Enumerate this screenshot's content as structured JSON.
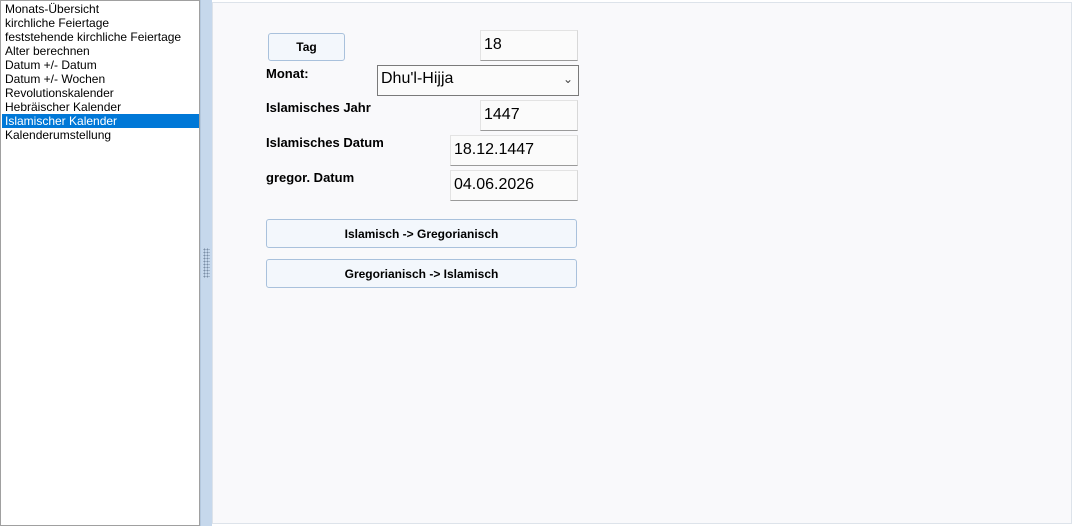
{
  "sidebar": {
    "items": [
      {
        "label": "Monats-Übersicht"
      },
      {
        "label": "kirchliche Feiertage"
      },
      {
        "label": "feststehende kirchliche Feiertage"
      },
      {
        "label": "Alter berechnen"
      },
      {
        "label": "Datum +/- Datum"
      },
      {
        "label": "Datum +/- Wochen"
      },
      {
        "label": "Revolutionskalender"
      },
      {
        "label": "Hebräischer Kalender"
      },
      {
        "label": "Islamischer Kalender"
      },
      {
        "label": "Kalenderumstellung"
      }
    ],
    "selected_index": 8
  },
  "form": {
    "tag_button": "Tag",
    "tag_value": "18",
    "monat_label": "Monat:",
    "monat_value": "Dhu'l-Hijja",
    "jahr_label": "Islamisches Jahr",
    "jahr_value": "1447",
    "islam_datum_label": "Islamisches Datum",
    "islam_datum_value": "18.12.1447",
    "gregor_label": "gregor. Datum",
    "gregor_value": "04.06.2026",
    "btn_islam_to_greg": "Islamisch -> Gregorianisch",
    "btn_greg_to_islam": "Gregorianisch -> Islamisch"
  },
  "colors": {
    "selection": "#0078d7",
    "splitter": "#c6d8ec",
    "button_border": "#a9c1dc"
  },
  "icons": {
    "dropdown": "chevron-down-icon",
    "grip": "splitter-grip-icon"
  }
}
